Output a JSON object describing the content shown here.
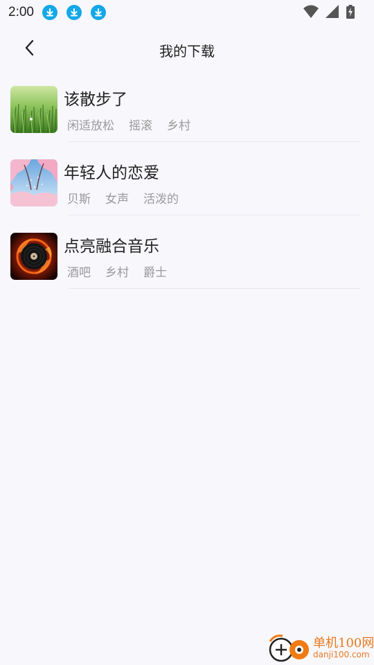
{
  "status_bar": {
    "time": "2:00",
    "notification_icons": [
      "download-icon",
      "download-icon",
      "download-icon"
    ],
    "right_icons": [
      "wifi-icon",
      "signal-icon",
      "battery-charging-icon"
    ]
  },
  "header": {
    "back_icon": "chevron-left-icon",
    "title": "我的下载"
  },
  "songs": [
    {
      "title": "该散步了",
      "tags": [
        "闲适放松",
        "摇滚",
        "乡村"
      ],
      "cover": "green-grass-cover"
    },
    {
      "title": "年轻人的恋爱",
      "tags": [
        "贝斯",
        "女声",
        "活泼的"
      ],
      "cover": "cherry-blossom-cover"
    },
    {
      "title": "点亮融合音乐",
      "tags": [
        "酒吧",
        "乡村",
        "爵士"
      ],
      "cover": "fiery-vinyl-cover"
    }
  ],
  "watermark": {
    "name": "单机100网",
    "domain": "danji100.com"
  },
  "colors": {
    "background": "#f7f7fc",
    "accent_blue": "#13a8e8",
    "tag_gray": "#9a9a9a",
    "watermark_orange": "#e87a1e"
  }
}
